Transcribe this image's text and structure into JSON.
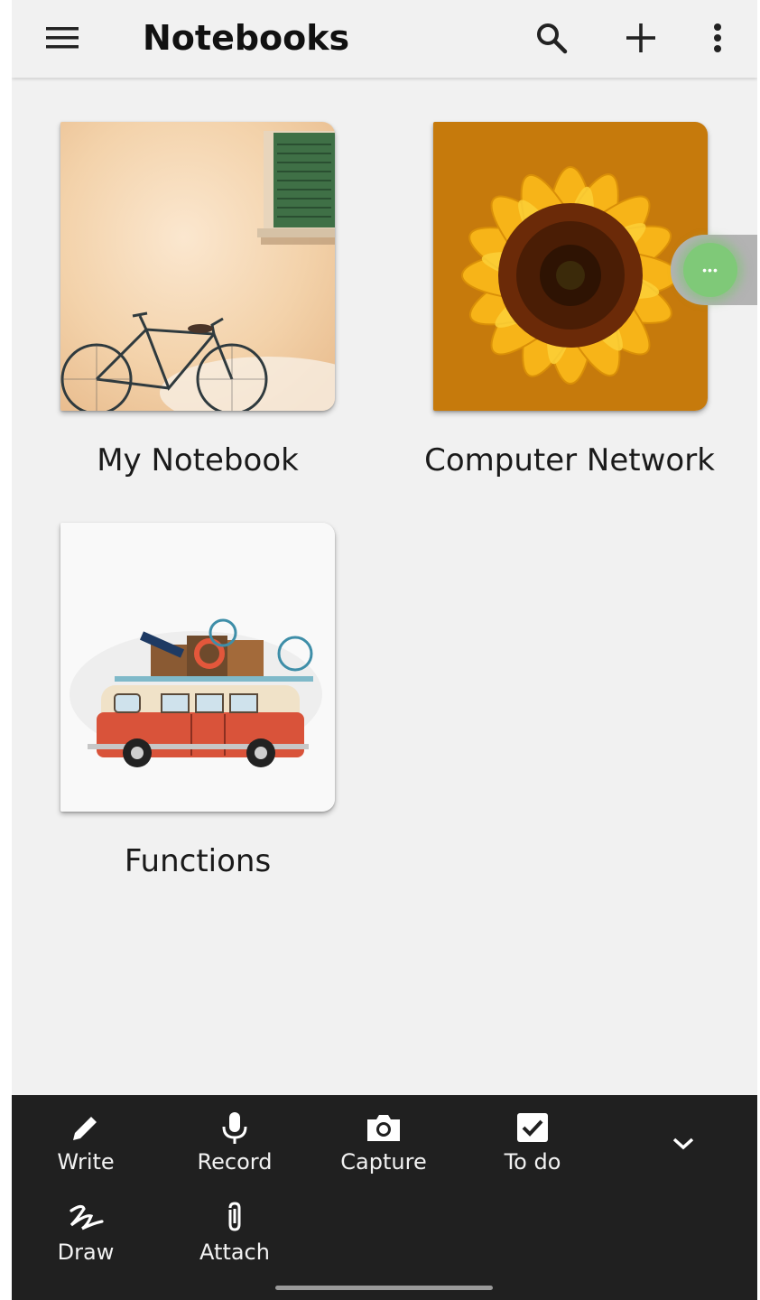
{
  "appbar": {
    "title": "Notebooks",
    "menu_icon": "hamburger-menu-icon",
    "search_icon": "search-icon",
    "add_icon": "plus-icon",
    "more_icon": "more-vertical-icon"
  },
  "notebooks": [
    {
      "label": "My Notebook",
      "cover": "bicycle-wall-illustration"
    },
    {
      "label": "Computer Network",
      "cover": "sunflower-photo"
    },
    {
      "label": "Functions",
      "cover": "camper-van-illustration"
    }
  ],
  "floating_handle": {
    "icon": "more-horizontal-icon",
    "text": "•••"
  },
  "toolbar": {
    "items": [
      {
        "label": "Write",
        "icon": "pencil-icon"
      },
      {
        "label": "Record",
        "icon": "microphone-icon"
      },
      {
        "label": "Capture",
        "icon": "camera-icon"
      },
      {
        "label": "To do",
        "icon": "checkbox-icon"
      },
      {
        "label": "Draw",
        "icon": "scribble-icon"
      },
      {
        "label": "Attach",
        "icon": "paperclip-icon"
      }
    ],
    "collapse_icon": "chevron-down-icon"
  },
  "colors": {
    "background": "#f1f1f1",
    "toolbar": "#202020",
    "floating_accent": "#7fc978"
  }
}
